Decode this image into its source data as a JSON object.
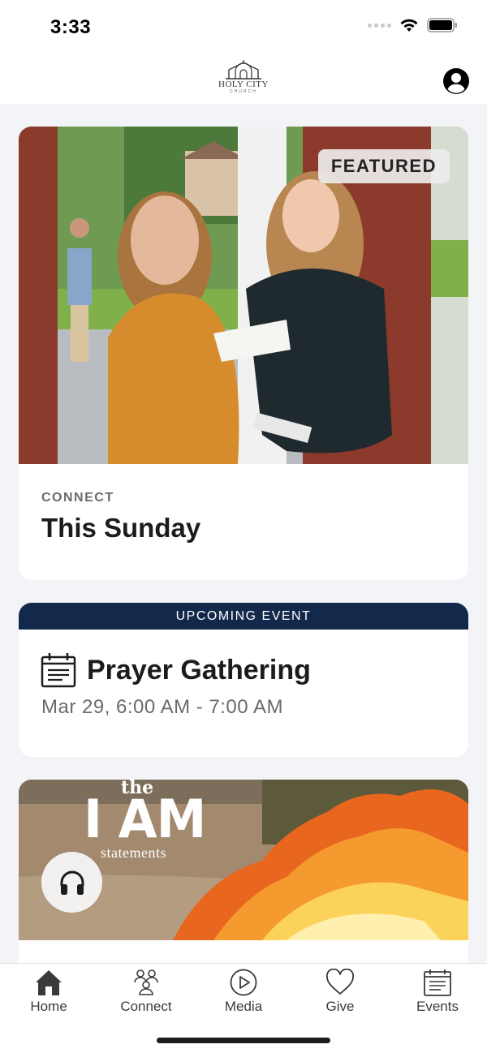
{
  "status_bar": {
    "time": "3:33"
  },
  "header": {
    "logo_name": "HOLY CITY",
    "logo_sub": "CHURCH",
    "profile_icon": "person-circle-icon"
  },
  "featured": {
    "badge": "FEATURED",
    "category": "CONNECT",
    "title": "This Sunday"
  },
  "event": {
    "banner": "UPCOMING EVENT",
    "title": "Prayer Gathering",
    "time": "Mar 29, 6:00 AM - 7:00 AM",
    "icon": "calendar-icon"
  },
  "media": {
    "artwork_line1": "the",
    "artwork_line2": "I AM",
    "artwork_line3": "statements",
    "listen_icon": "headphones-icon"
  },
  "tabs": [
    {
      "label": "Home",
      "icon": "home-icon"
    },
    {
      "label": "Connect",
      "icon": "people-icon"
    },
    {
      "label": "Media",
      "icon": "play-icon"
    },
    {
      "label": "Give",
      "icon": "heart-icon"
    },
    {
      "label": "Events",
      "icon": "calendar-icon"
    }
  ],
  "colors": {
    "event_banner": "#13294b",
    "background": "#f3f4f8"
  }
}
